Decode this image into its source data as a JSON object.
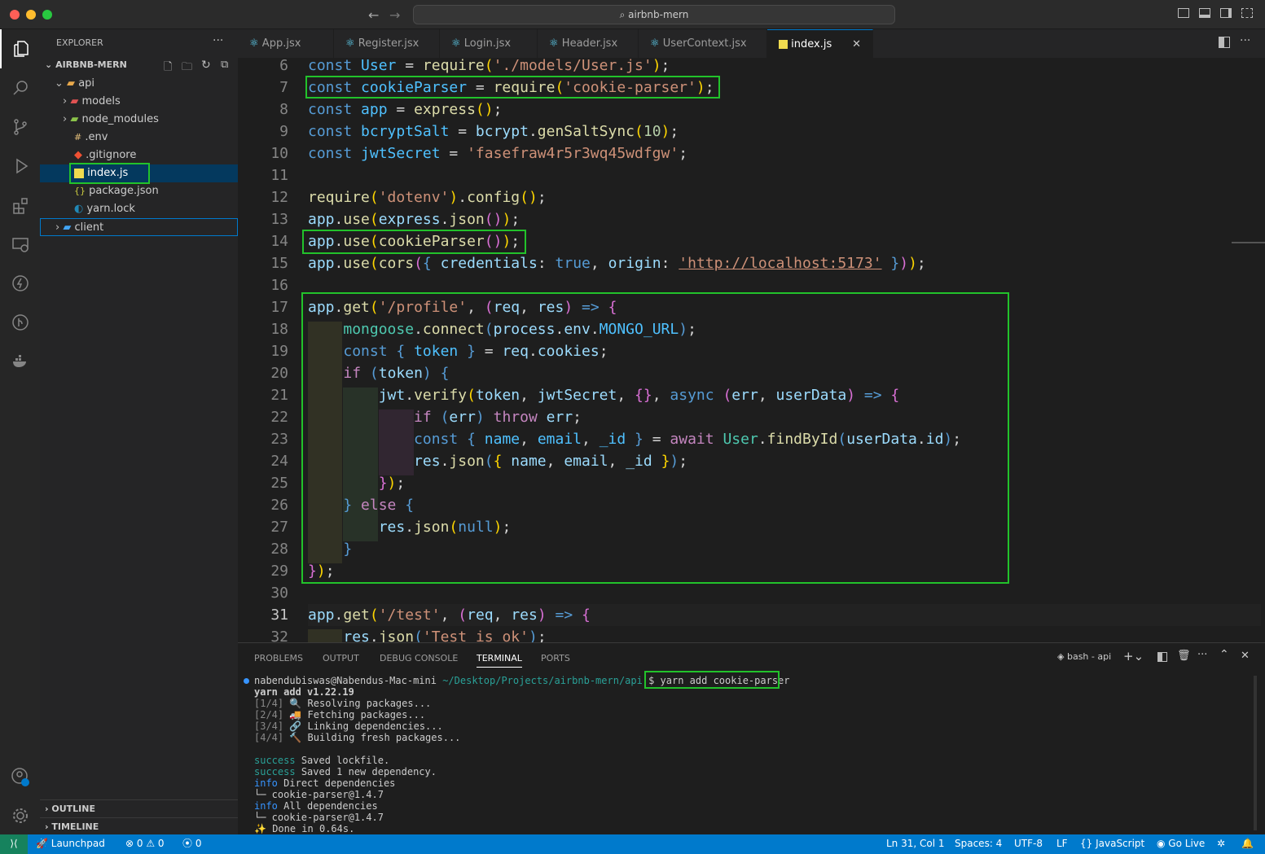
{
  "window": {
    "title": "airbnb-mern"
  },
  "explorer": {
    "header": "EXPLORER",
    "project": "AIRBNB-MERN",
    "items": [
      "api",
      "models",
      "node_modules",
      ".env",
      ".gitignore",
      "index.js",
      "package.json",
      "yarn.lock",
      "client"
    ],
    "outline": "OUTLINE",
    "timeline": "TIMELINE"
  },
  "tabs": [
    "App.jsx",
    "Register.jsx",
    "Login.jsx",
    "Header.jsx",
    "UserContext.jsx",
    "index.js"
  ],
  "code": {
    "line_numbers": [
      "6",
      "7",
      "8",
      "9",
      "10",
      "11",
      "12",
      "13",
      "14",
      "15",
      "16",
      "17",
      "18",
      "19",
      "20",
      "21",
      "22",
      "23",
      "24",
      "25",
      "26",
      "27",
      "28",
      "29",
      "30",
      "31",
      "32"
    ]
  },
  "panel": {
    "tabs": [
      "PROBLEMS",
      "OUTPUT",
      "DEBUG CONSOLE",
      "TERMINAL",
      "PORTS"
    ],
    "terminal_name": "bash - api",
    "prompt_user": "nabendubiswas@Nabendus-Mac-mini",
    "prompt_path": "~/Desktop/Projects/airbnb-mern/api",
    "prompt_symbol": "$",
    "command": "yarn add cookie-parser",
    "lines": [
      "yarn add v1.22.19",
      "[1/4]",
      "Resolving packages...",
      "[2/4]",
      "Fetching packages...",
      "[3/4]",
      "Linking dependencies...",
      "[4/4]",
      "Building fresh packages...",
      "success",
      "Saved lockfile.",
      "success",
      "Saved 1 new dependency.",
      "info",
      "Direct dependencies",
      "└─ cookie-parser@1.4.7",
      "info",
      "All dependencies",
      "└─ cookie-parser@1.4.7",
      "✨",
      "Done in 0.64s."
    ]
  },
  "status": {
    "launchpad": "Launchpad",
    "errors": "0",
    "warnings": "0",
    "ports": "0",
    "position": "Ln 31, Col 1",
    "spaces": "Spaces: 4",
    "encoding": "UTF-8",
    "eol": "LF",
    "language": "JavaScript",
    "golive": "Go Live"
  },
  "colors": {
    "accent": "#007acc",
    "highlight": "#22c22b"
  }
}
